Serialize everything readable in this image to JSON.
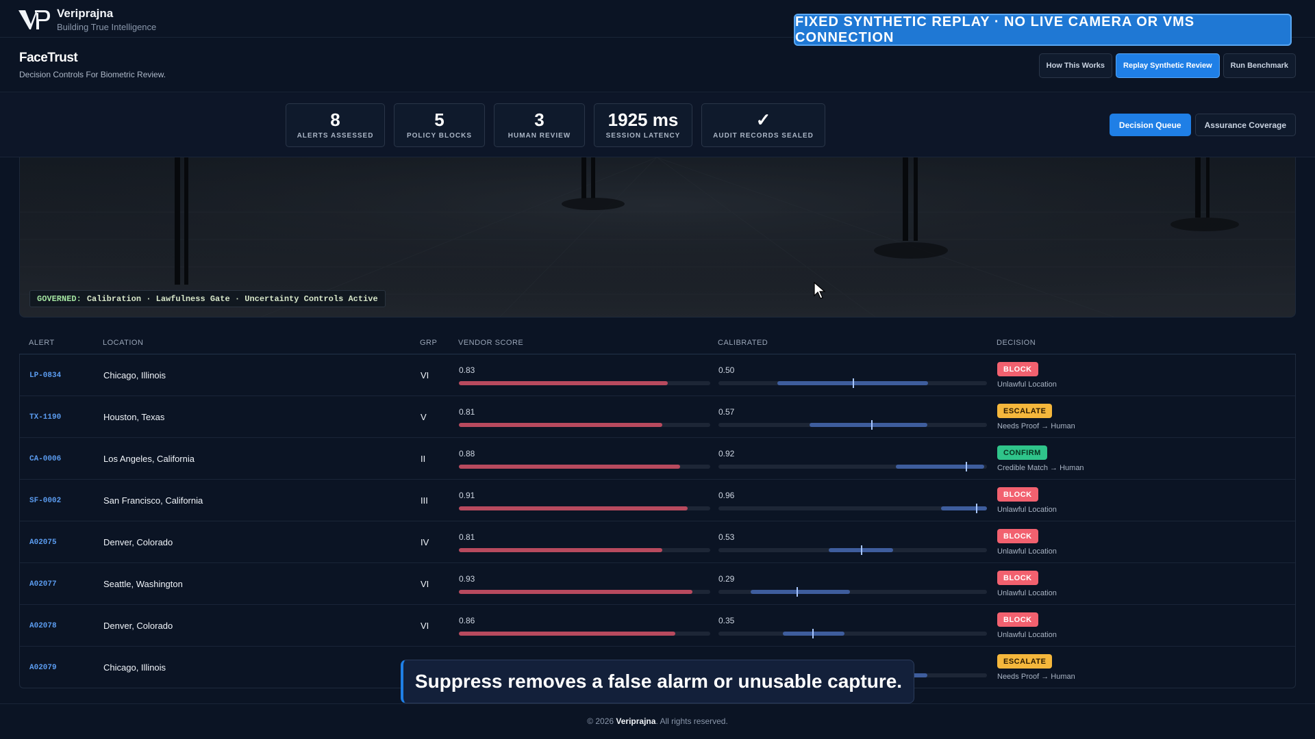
{
  "brand": {
    "name": "Veriprajna",
    "tagline": "Building True Intelligence"
  },
  "banner": "FIXED SYNTHETIC REPLAY · NO LIVE CAMERA OR VMS CONNECTION",
  "product": {
    "title": "FaceTrust",
    "subtitle": "Decision Controls For Biometric Review."
  },
  "header_buttons": [
    "How This Works",
    "Replay Synthetic Review",
    "Run Benchmark"
  ],
  "stats": [
    {
      "value": "8",
      "label": "ALERTS ASSESSED"
    },
    {
      "value": "5",
      "label": "POLICY BLOCKS"
    },
    {
      "value": "3",
      "label": "HUMAN REVIEW"
    },
    {
      "value": "1925 ms",
      "label": "SESSION LATENCY"
    },
    {
      "value": "✓",
      "label": "AUDIT RECORDS SEALED"
    }
  ],
  "tabs": [
    "Decision Queue",
    "Assurance Coverage"
  ],
  "governance": {
    "key": "GOVERNED:",
    "text": "Calibration · Lawfulness Gate · Uncertainty Controls Active"
  },
  "table": {
    "columns": [
      "ALERT",
      "LOCATION",
      "GRP",
      "VENDOR SCORE",
      "CALIBRATED",
      "DECISION"
    ],
    "rows": [
      {
        "id": "LP-0834",
        "location": "Chicago, Illinois",
        "grp": "VI",
        "vendor": "0.83",
        "vendor_val": 0.83,
        "cal": "0.50",
        "cal_val": 0.5,
        "cal_lo": 0.22,
        "cal_hi": 0.78,
        "decision": "BLOCK",
        "reason": "Unlawful Location"
      },
      {
        "id": "TX-1190",
        "location": "Houston, Texas",
        "grp": "V",
        "vendor": "0.81",
        "vendor_val": 0.81,
        "cal": "0.57",
        "cal_val": 0.57,
        "cal_lo": 0.34,
        "cal_hi": 0.78,
        "decision": "ESCALATE",
        "reason": "Needs Proof → Human"
      },
      {
        "id": "CA-0006",
        "location": "Los Angeles, California",
        "grp": "II",
        "vendor": "0.88",
        "vendor_val": 0.88,
        "cal": "0.92",
        "cal_val": 0.92,
        "cal_lo": 0.66,
        "cal_hi": 0.99,
        "decision": "CONFIRM",
        "reason": "Credible Match → Human"
      },
      {
        "id": "SF-0002",
        "location": "San Francisco, California",
        "grp": "III",
        "vendor": "0.91",
        "vendor_val": 0.91,
        "cal": "0.96",
        "cal_val": 0.96,
        "cal_lo": 0.83,
        "cal_hi": 1.0,
        "decision": "BLOCK",
        "reason": "Unlawful Location"
      },
      {
        "id": "A02075",
        "location": "Denver, Colorado",
        "grp": "IV",
        "vendor": "0.81",
        "vendor_val": 0.81,
        "cal": "0.53",
        "cal_val": 0.53,
        "cal_lo": 0.41,
        "cal_hi": 0.65,
        "decision": "BLOCK",
        "reason": "Unlawful Location"
      },
      {
        "id": "A02077",
        "location": "Seattle, Washington",
        "grp": "VI",
        "vendor": "0.93",
        "vendor_val": 0.93,
        "cal": "0.29",
        "cal_val": 0.29,
        "cal_lo": 0.12,
        "cal_hi": 0.49,
        "decision": "BLOCK",
        "reason": "Unlawful Location"
      },
      {
        "id": "A02078",
        "location": "Denver, Colorado",
        "grp": "VI",
        "vendor": "0.86",
        "vendor_val": 0.86,
        "cal": "0.35",
        "cal_val": 0.35,
        "cal_lo": 0.24,
        "cal_hi": 0.47,
        "decision": "BLOCK",
        "reason": "Unlawful Location"
      },
      {
        "id": "A02079",
        "location": "Chicago, Illinois",
        "grp": "",
        "vendor": "",
        "vendor_val": null,
        "cal": "",
        "cal_val": null,
        "cal_lo": 0.7,
        "cal_hi": 0.78,
        "decision": "ESCALATE",
        "reason": "Needs Proof → Human"
      }
    ]
  },
  "caption": "Suppress removes a false alarm or unusable capture.",
  "footer": {
    "prefix": "© 2026",
    "brand": "Veriprajna",
    "suffix": ". All rights reserved."
  },
  "colors": {
    "accent": "#1f7fe6",
    "block": "#f2616f",
    "escalate": "#f5b73c",
    "confirm": "#2fc48a",
    "vendor_bar": "#b84a5e",
    "cal_band": "#3e5d9d"
  }
}
